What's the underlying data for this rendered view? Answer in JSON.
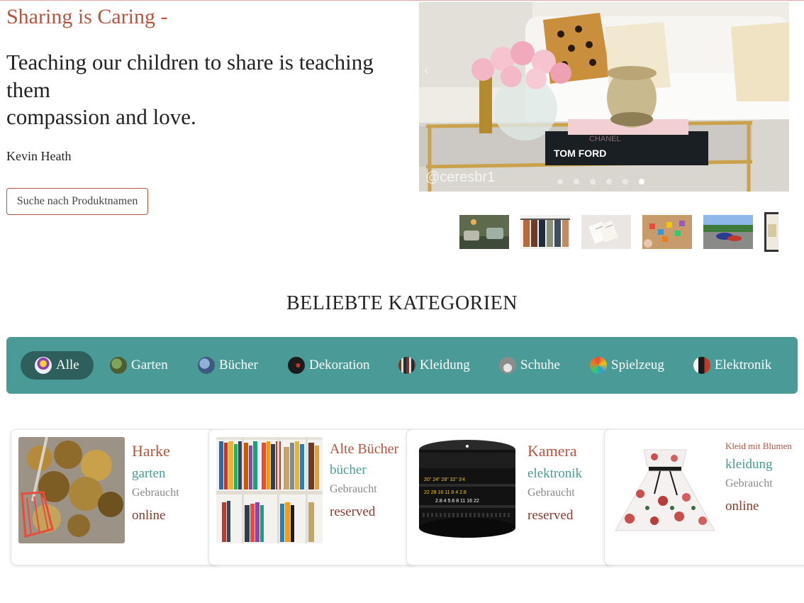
{
  "hero": {
    "title": "Sharing is Caring -",
    "quote_line1": "Teaching our children to share is teaching them",
    "quote_line2": "compassion and love.",
    "author": "Kevin Heath",
    "search_button": "Suche nach Produktnamen"
  },
  "carousel": {
    "watermark": "@ceresbr1",
    "book_top": "CHANEL",
    "book_bottom": "TOM FORD",
    "slide_count": 6,
    "active_slide": 6,
    "thumbnails": [
      "patio-chairs",
      "clothing-rack",
      "open-book",
      "toy-blocks",
      "sneakers-on-path",
      "living-room"
    ]
  },
  "categories": {
    "title": "BELIEBTE KATEGORIEN",
    "items": [
      {
        "label": "Alle",
        "icon": "all-icon",
        "active": true
      },
      {
        "label": "Garten",
        "icon": "garden-icon"
      },
      {
        "label": "Bücher",
        "icon": "books-icon"
      },
      {
        "label": "Dekoration",
        "icon": "decoration-icon"
      },
      {
        "label": "Kleidung",
        "icon": "clothing-icon"
      },
      {
        "label": "Schuhe",
        "icon": "shoes-icon"
      },
      {
        "label": "Spielzeug",
        "icon": "toys-icon"
      },
      {
        "label": "Elektronik",
        "icon": "electronics-icon"
      }
    ]
  },
  "products": [
    {
      "name": "Harke",
      "category": "garten",
      "condition": "Gebraucht",
      "status": "online"
    },
    {
      "name": "Alte Bücher",
      "category": "bücher",
      "condition": "Gebraucht",
      "status": "reserved"
    },
    {
      "name": "Kamera",
      "category": "elektronik",
      "condition": "Gebraucht",
      "status": "reserved"
    },
    {
      "name": "Kleid mit Blumen",
      "category": "kleidung",
      "condition": "Gebraucht",
      "status": "online"
    }
  ],
  "colors": {
    "accent": "#b7543e",
    "teal": "#4a9b98",
    "teal_dark": "#2e5f5d",
    "status": "#8a3a2c"
  }
}
